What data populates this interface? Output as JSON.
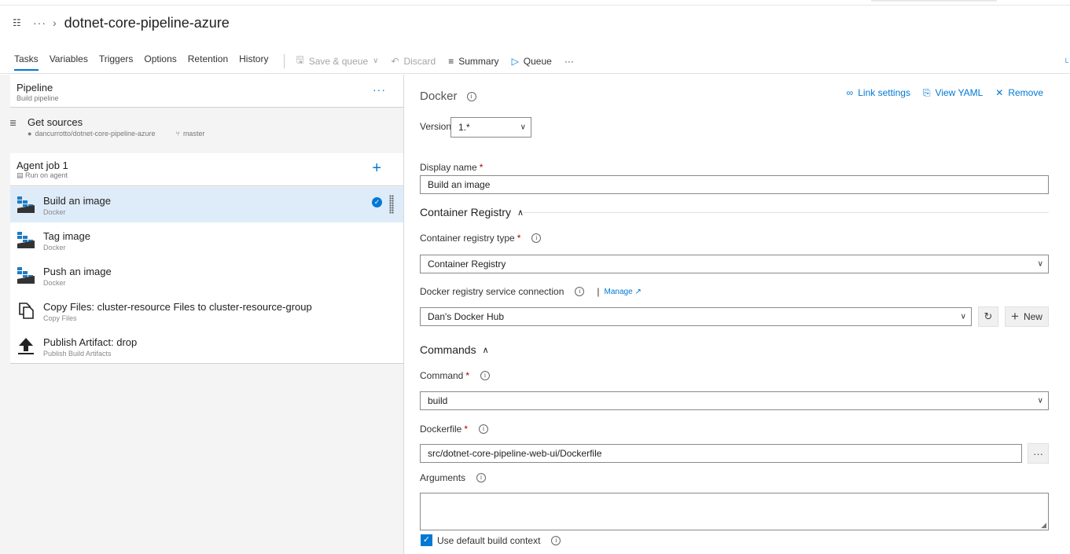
{
  "breadcrumb": {
    "icon": "org-icon",
    "ellipsis": "···",
    "separator": "›",
    "title": "dotnet-core-pipeline-azure"
  },
  "tabs": [
    {
      "label": "Tasks",
      "active": true
    },
    {
      "label": "Variables"
    },
    {
      "label": "Triggers"
    },
    {
      "label": "Options"
    },
    {
      "label": "Retention"
    },
    {
      "label": "History"
    }
  ],
  "toolbar": {
    "save_queue": "Save & queue",
    "discard": "Discard",
    "summary": "Summary",
    "queue": "Queue",
    "more": "···"
  },
  "pipeline": {
    "title": "Pipeline",
    "subtitle": "Build pipeline",
    "more": "···"
  },
  "sources": {
    "title": "Get sources",
    "repo": "dancurrotto/dotnet-core-pipeline-azure",
    "branch": "master"
  },
  "agent_job": {
    "title": "Agent job 1",
    "subtitle": "Run on agent",
    "add": "+"
  },
  "tasks": [
    {
      "title": "Build an image",
      "subtitle": "Docker",
      "icon": "docker-icon",
      "selected": true
    },
    {
      "title": "Tag image",
      "subtitle": "Docker",
      "icon": "docker-icon"
    },
    {
      "title": "Push an image",
      "subtitle": "Docker",
      "icon": "docker-icon"
    },
    {
      "title": "Copy Files: cluster-resource Files to cluster-resource-group",
      "subtitle": "Copy Files",
      "icon": "copy-files-icon"
    },
    {
      "title": "Publish Artifact: drop",
      "subtitle": "Publish Build Artifacts",
      "icon": "publish-artifact-icon"
    }
  ],
  "details": {
    "title": "Docker",
    "links": {
      "link_settings": "Link settings",
      "view_yaml": "View YAML",
      "remove": "Remove"
    },
    "version_label": "Version",
    "version_value": "1.*",
    "display_name_label": "Display name",
    "display_name_value": "Build an image",
    "container_registry_section": "Container Registry",
    "registry_type_label": "Container registry type",
    "registry_type_value": "Container Registry",
    "service_conn_label": "Docker registry service connection",
    "manage_label": "Manage",
    "service_conn_value": "Dan's Docker Hub",
    "new_label": "New",
    "commands_section": "Commands",
    "command_label": "Command",
    "command_value": "build",
    "dockerfile_label": "Dockerfile",
    "dockerfile_value": "src/dotnet-core-pipeline-web-ui/Dockerfile",
    "browse_label": "···",
    "arguments_label": "Arguments",
    "arguments_value": "",
    "default_context_label": "Use default build context",
    "default_context_checked": true,
    "required_marker": "*"
  },
  "colors": {
    "accent": "#0078d4",
    "selected_row": "#deecf9",
    "required": "#a80000"
  }
}
